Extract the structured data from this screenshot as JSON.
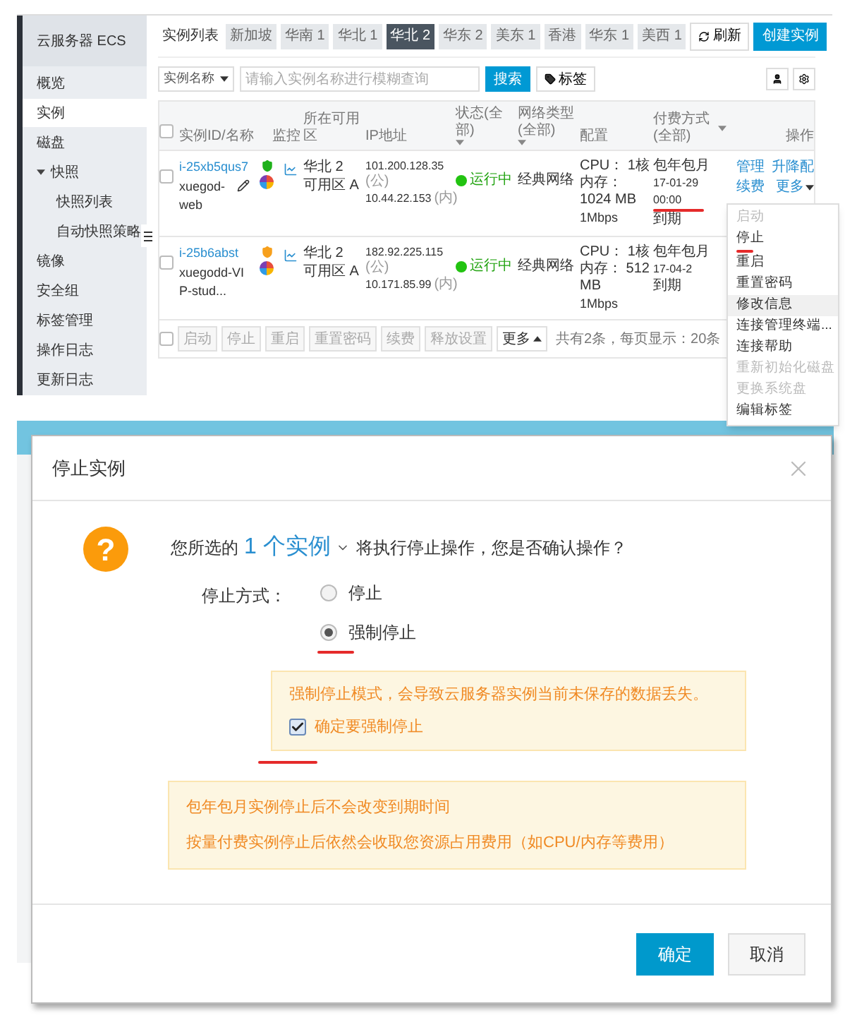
{
  "console": {
    "sidebar": {
      "title": "云服务器 ECS",
      "items": [
        {
          "label": "概览",
          "selected": false
        },
        {
          "label": "实例",
          "selected": true
        },
        {
          "label": "磁盘",
          "selected": false
        },
        {
          "label": "快照",
          "selected": false,
          "expanded": true,
          "children": [
            {
              "label": "快照列表",
              "selected": false
            },
            {
              "label": "自动快照策略",
              "selected": false
            }
          ]
        },
        {
          "label": "镜像",
          "selected": false
        },
        {
          "label": "安全组",
          "selected": false
        },
        {
          "label": "标签管理",
          "selected": false
        },
        {
          "label": "操作日志",
          "selected": false
        },
        {
          "label": "更新日志",
          "selected": false
        }
      ]
    },
    "header": {
      "title": "实例列表",
      "regions": [
        {
          "label": "新加坡",
          "selected": false
        },
        {
          "label": "华南 1",
          "selected": false
        },
        {
          "label": "华北 1",
          "selected": false
        },
        {
          "label": "华北 2",
          "selected": true
        },
        {
          "label": "华东 2",
          "selected": false
        },
        {
          "label": "美东 1",
          "selected": false
        },
        {
          "label": "香港",
          "selected": false
        },
        {
          "label": "华东 1",
          "selected": false
        },
        {
          "label": "美西 1",
          "selected": false
        }
      ],
      "buttons": [
        {
          "label": "刷新",
          "kind": "refresh"
        },
        {
          "label": "创建实例",
          "kind": "primary"
        }
      ]
    },
    "filter": {
      "select": "实例名称",
      "placeholder": "请输入实例名称进行模糊查询",
      "search_button": "搜索",
      "tag_button": "标签"
    },
    "table": {
      "select_all": false,
      "columns": [
        {
          "label": "实例ID/名称",
          "filter": false
        },
        {
          "label": "监控",
          "filter": false
        },
        {
          "label": "所在可用区",
          "filter": false
        },
        {
          "label": "IP地址",
          "filter": false
        },
        {
          "label": "状态(全部)",
          "filter": true
        },
        {
          "label": "网络类型(全部)",
          "filter": true
        },
        {
          "label": "配置",
          "filter": false
        },
        {
          "label": "付费方式(全部)",
          "filter": true
        },
        {
          "label": "操作",
          "filter": false
        }
      ],
      "rows": [
        {
          "checked": false,
          "id": "i-25xb5qus7",
          "name": "xuegod-web",
          "hovered": true,
          "color": "#1fb11b",
          "zone": "华北 2 可用区 A",
          "ip_public": "101.200.128.35",
          "ip_public_tag": "(公)",
          "ip_private": "10.44.22.153",
          "ip_private_tag": "(内)",
          "status": "运行中",
          "network": "经典网络",
          "cpu": "CPU： 1核",
          "memory": "内存： 1024 MB",
          "bandwidth": "1Mbps",
          "billing": "包年包月",
          "expiry": "17-01-29 00:00",
          "expiry_note": "到期",
          "underlined": true,
          "more_open": true,
          "actions": [
            "管理",
            "升降配",
            "续费",
            "更多"
          ]
        },
        {
          "checked": false,
          "id": "i-25b6abst",
          "name": "xuegodd-VIP-stud...",
          "hovered": false,
          "color": "#f7a01d",
          "zone": "华北 2 可用区 A",
          "ip_public": "182.92.225.115",
          "ip_public_tag": "(公)",
          "ip_private": "10.171.85.99",
          "ip_private_tag": "(内)",
          "status": "运行中",
          "network": "经典网络",
          "cpu": "CPU： 1核",
          "memory": "内存： 512 MB",
          "bandwidth": "1Mbps",
          "billing": "包年包月",
          "expiry": "17-04-2",
          "expiry_note": "到期",
          "underlined": false,
          "more_open": false
        }
      ]
    },
    "bulk_bar": {
      "checked": false,
      "buttons": [
        "启动",
        "停止",
        "重启",
        "重置密码",
        "续费",
        "释放设置",
        "更多"
      ],
      "pagination": "共有2条，每页显示：20条"
    },
    "more_menu": {
      "items": [
        {
          "label": "启动",
          "disabled": true,
          "selected": false,
          "underlined": false
        },
        {
          "label": "停止",
          "disabled": false,
          "selected": false,
          "underlined": true
        },
        {
          "label": "重启",
          "disabled": false,
          "selected": false,
          "underlined": false
        },
        {
          "label": "重置密码",
          "disabled": false,
          "selected": false,
          "underlined": false
        },
        {
          "label": "修改信息",
          "disabled": false,
          "selected": true,
          "underlined": false
        },
        {
          "label": "连接管理终端...",
          "disabled": false,
          "selected": false,
          "underlined": false
        },
        {
          "label": "连接帮助",
          "disabled": false,
          "selected": false,
          "underlined": false
        },
        {
          "label": "重新初始化磁盘",
          "disabled": true,
          "selected": false,
          "underlined": false
        },
        {
          "label": "更换系统盘",
          "disabled": true,
          "selected": false,
          "underlined": false
        },
        {
          "label": "编辑标签",
          "disabled": false,
          "selected": false,
          "underlined": false
        }
      ]
    }
  },
  "dialog": {
    "title": "停止实例",
    "question_mark": "?",
    "prefix": "您所选的",
    "count_link": "1 个实例",
    "suffix": "将执行停止操作，您是否确认操作？",
    "field_label": "停止方式：",
    "options": [
      {
        "label": "停止",
        "selected": false,
        "underlined": false
      },
      {
        "label": "强制停止",
        "selected": true,
        "underlined": true
      }
    ],
    "warning": "强制停止模式，会导致云服务器实例当前未保存的数据丢失。",
    "confirm": {
      "label": "确定要强制停止",
      "checked": true,
      "underlined": true
    },
    "notes": [
      "包年包月实例停止后不会改变到期时间",
      "按量付费实例停止后依然会收取您资源占用费用（如CPU/内存等费用）"
    ],
    "buttons": [
      {
        "label": "确定",
        "kind": "primary"
      },
      {
        "label": "取消",
        "kind": "default"
      }
    ]
  }
}
